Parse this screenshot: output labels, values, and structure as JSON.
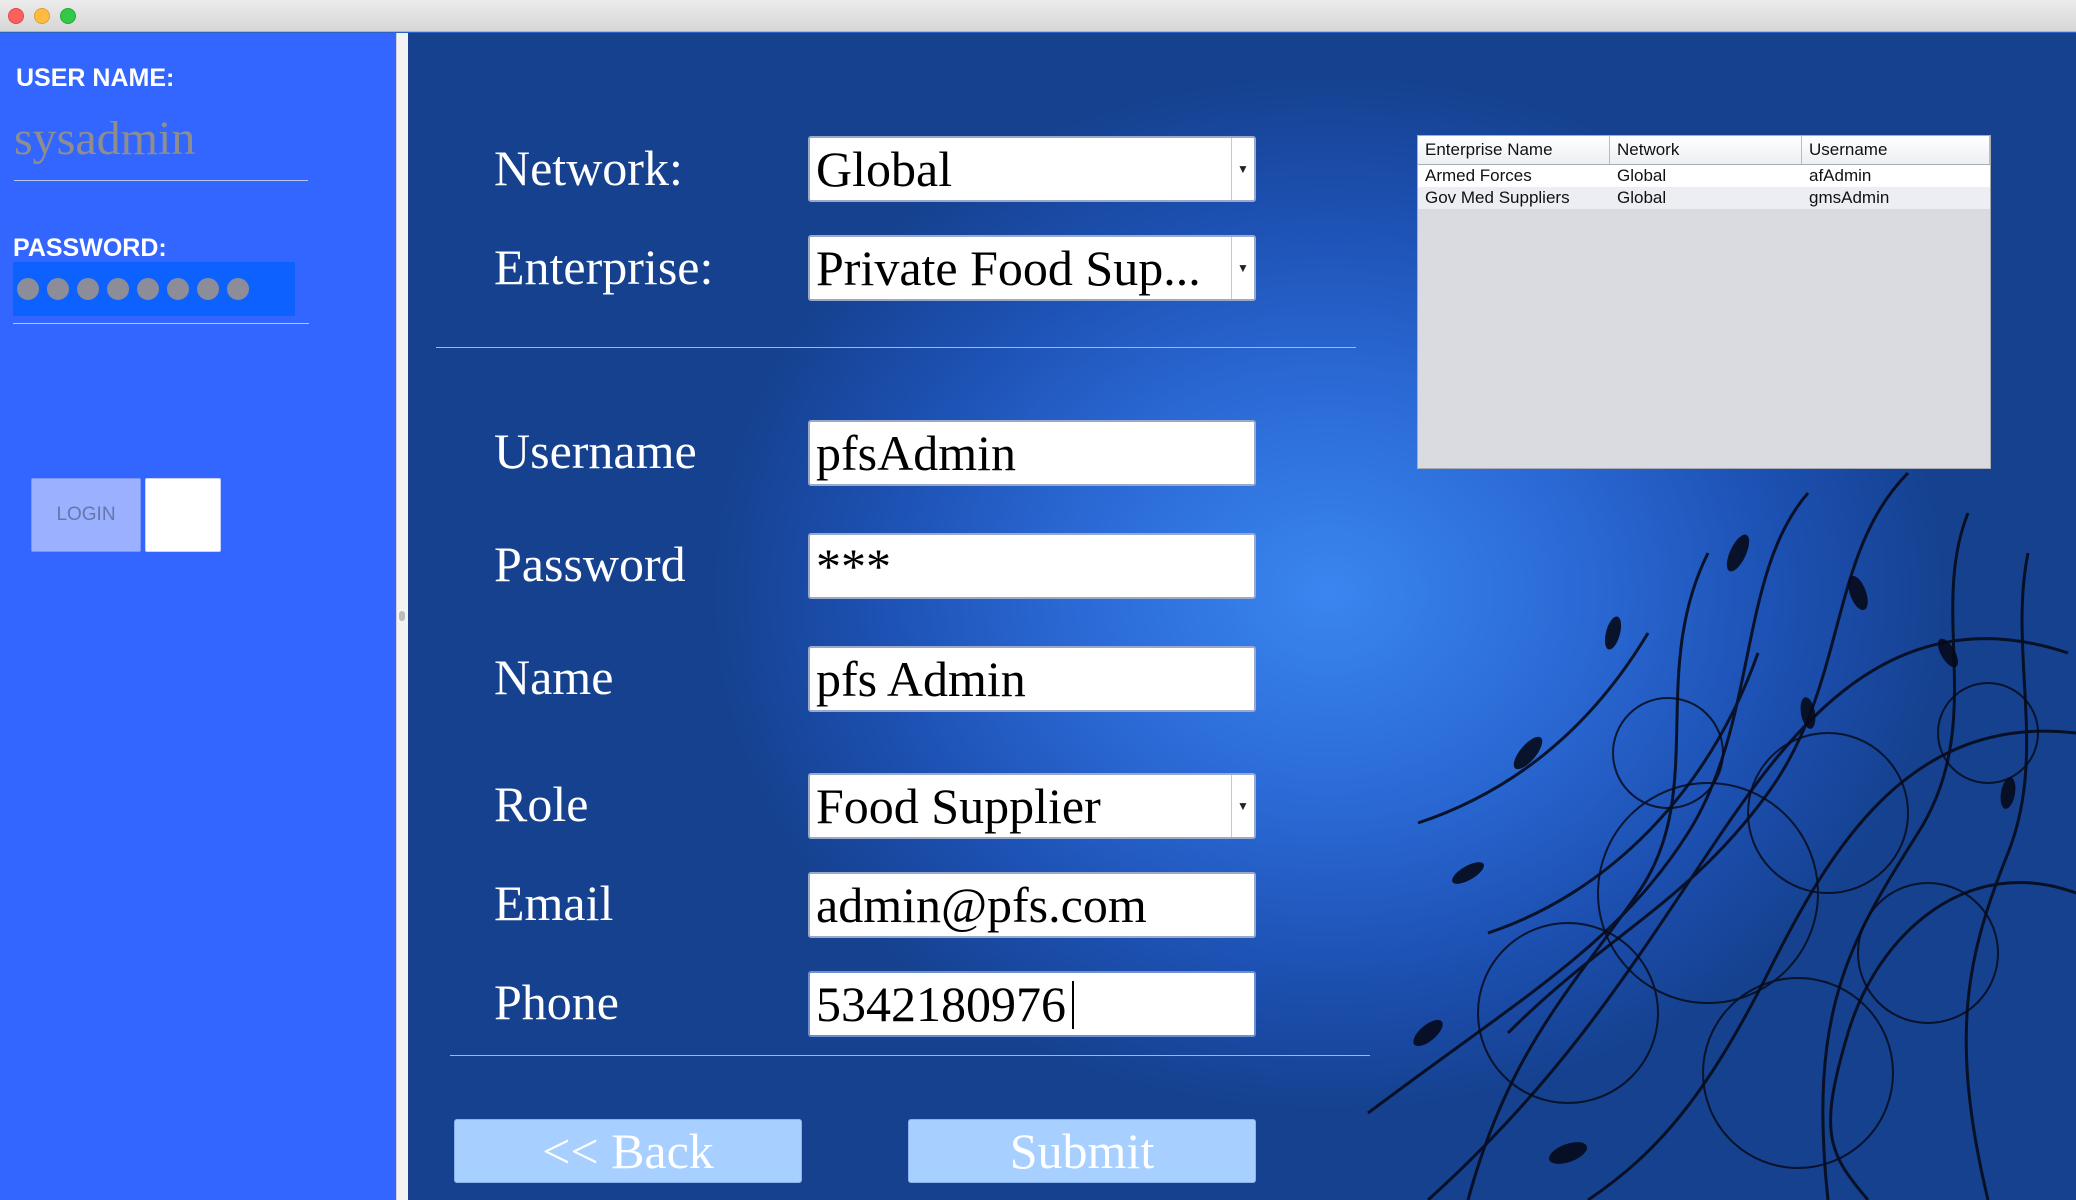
{
  "left": {
    "username_label": "USER NAME:",
    "username_value": "sysadmin",
    "password_label": "PASSWORD:",
    "password_mask_count": 8,
    "login_label": "LOGIN"
  },
  "form": {
    "network": {
      "label": "Network:",
      "value": "Global"
    },
    "enterprise": {
      "label": "Enterprise:",
      "value": "Private Food Sup..."
    },
    "username": {
      "label": "Username",
      "value": "pfsAdmin"
    },
    "password": {
      "label": "Password",
      "value": "***"
    },
    "name": {
      "label": "Name",
      "value": "pfs Admin"
    },
    "role": {
      "label": "Role",
      "value": "Food Supplier"
    },
    "email": {
      "label": "Email",
      "value": "admin@pfs.com"
    },
    "phone": {
      "label": "Phone",
      "value": "5342180976"
    },
    "back_label": "<< Back",
    "submit_label": "Submit"
  },
  "table": {
    "headers": [
      "Enterprise Name",
      "Network",
      "Username"
    ],
    "rows": [
      [
        "Armed Forces",
        "Global",
        "afAdmin"
      ],
      [
        "Gov Med Suppliers",
        "Global",
        "gmsAdmin"
      ]
    ]
  },
  "colors": {
    "left_panel": "#3366ff",
    "button_fill": "#a7cfff"
  },
  "icons": {
    "combo_arrow": "chevron-down-icon"
  }
}
